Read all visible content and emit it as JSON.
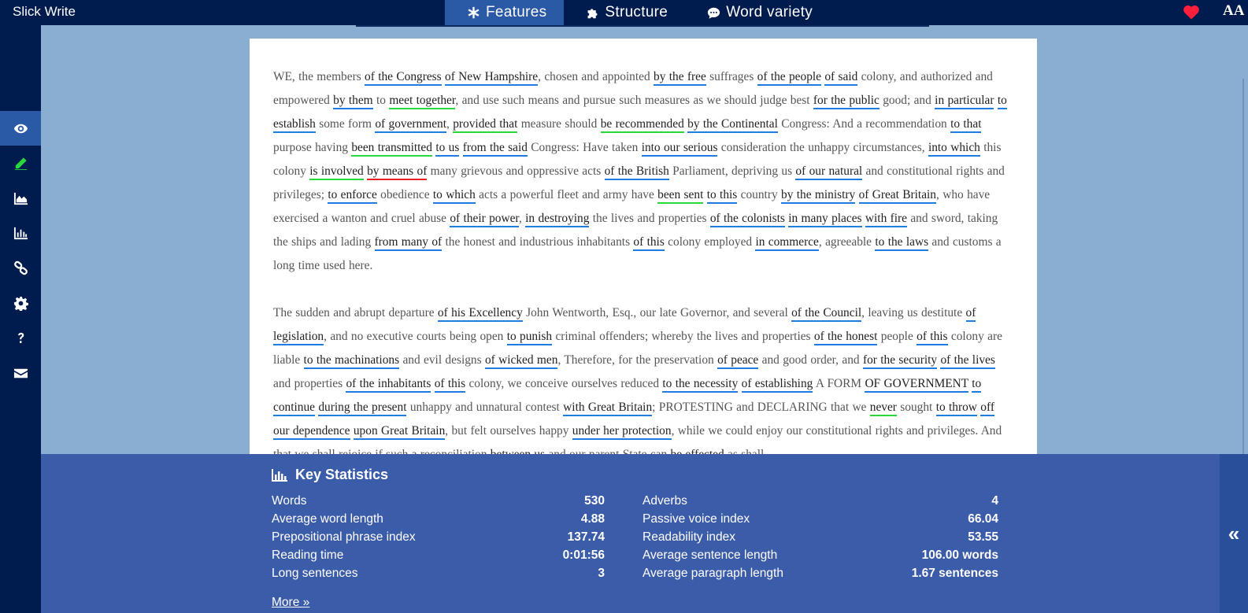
{
  "app": {
    "title": "Slick Write"
  },
  "tabs": [
    {
      "label": "Features",
      "icon": "asterisk-icon",
      "active": true
    },
    {
      "label": "Structure",
      "icon": "puzzle-icon",
      "active": false
    },
    {
      "label": "Word variety",
      "icon": "speech-bubble-icon",
      "active": false
    }
  ],
  "top_right": {
    "heart_icon": "heart-icon",
    "font_toggle": "AA"
  },
  "sidebar": [
    {
      "icon": "eye-icon",
      "active": true
    },
    {
      "icon": "pencil-icon",
      "active": false
    },
    {
      "icon": "area-chart-icon",
      "active": false
    },
    {
      "icon": "bar-chart-icon",
      "active": false
    },
    {
      "icon": "link-icon",
      "active": false
    },
    {
      "icon": "gear-icon",
      "active": false
    },
    {
      "icon": "question-icon",
      "active": false
    },
    {
      "icon": "envelope-icon",
      "active": false
    }
  ],
  "colors": {
    "prepositional": "#1e7de0",
    "passive": "#27d83a",
    "weak_word": "#e82020"
  },
  "document": {
    "paragraphs": [
      [
        [
          "t",
          "WE, the members "
        ],
        [
          "pp",
          "of the Congress"
        ],
        [
          "t",
          " "
        ],
        [
          "pp",
          "of New Hampshire"
        ],
        [
          "t",
          ", chosen and appointed "
        ],
        [
          "pp",
          "by the free"
        ],
        [
          "t",
          " suffrages "
        ],
        [
          "pp",
          "of the people"
        ],
        [
          "t",
          " "
        ],
        [
          "pp",
          "of said"
        ],
        [
          "t",
          " colony, and authorized and empowered "
        ],
        [
          "pp",
          "by them"
        ],
        [
          "t",
          " to "
        ],
        [
          "pv",
          "meet together"
        ],
        [
          "t",
          ", and use such means and pursue such measures as we should judge best "
        ],
        [
          "pp",
          "for the public"
        ],
        [
          "t",
          " good; and "
        ],
        [
          "pp",
          "in particular"
        ],
        [
          "t",
          " "
        ],
        [
          "pp",
          "to establish"
        ],
        [
          "t",
          " some form "
        ],
        [
          "pp",
          "of government"
        ],
        [
          "t",
          ", "
        ],
        [
          "pv",
          "provided that"
        ],
        [
          "t",
          " measure should "
        ],
        [
          "pv",
          "be recommended"
        ],
        [
          "t",
          " "
        ],
        [
          "pp",
          "by the Continental"
        ],
        [
          "t",
          " Congress: And a recommendation "
        ],
        [
          "pp",
          "to that"
        ],
        [
          "t",
          " purpose having "
        ],
        [
          "pv",
          "been transmitted"
        ],
        [
          "t",
          " "
        ],
        [
          "pp",
          "to us"
        ],
        [
          "t",
          " "
        ],
        [
          "pp",
          "from the said"
        ],
        [
          "t",
          " Congress: Have taken "
        ],
        [
          "pp",
          "into our serious"
        ],
        [
          "t",
          " consideration the unhappy circumstances, "
        ],
        [
          "pp",
          "into which"
        ],
        [
          "t",
          " this colony "
        ],
        [
          "pv",
          "is involved"
        ],
        [
          "t",
          " "
        ],
        [
          "wd",
          "by means of"
        ],
        [
          "t",
          " many grievous and oppressive acts "
        ],
        [
          "pp",
          "of the British"
        ],
        [
          "t",
          " Parliament, depriving us "
        ],
        [
          "pp",
          "of our natural"
        ],
        [
          "t",
          " and constitutional rights and privileges; "
        ],
        [
          "pp",
          "to enforce"
        ],
        [
          "t",
          " obedience "
        ],
        [
          "pp",
          "to which"
        ],
        [
          "t",
          " acts a powerful fleet and army have "
        ],
        [
          "pv",
          "been sent"
        ],
        [
          "t",
          " "
        ],
        [
          "pp",
          "to this"
        ],
        [
          "t",
          " country "
        ],
        [
          "pp",
          "by the ministry"
        ],
        [
          "t",
          " "
        ],
        [
          "pp",
          "of Great Britain"
        ],
        [
          "t",
          ", who have exercised a wanton and cruel abuse "
        ],
        [
          "pp",
          "of their power"
        ],
        [
          "t",
          ", "
        ],
        [
          "pp",
          "in destroying"
        ],
        [
          "t",
          " the lives and properties "
        ],
        [
          "pp",
          "of the colonists"
        ],
        [
          "t",
          " "
        ],
        [
          "pp",
          "in many places"
        ],
        [
          "t",
          " "
        ],
        [
          "pp",
          "with fire"
        ],
        [
          "t",
          " and sword, taking the ships and lading "
        ],
        [
          "pp",
          "from many of"
        ],
        [
          "t",
          " the honest and industrious inhabitants "
        ],
        [
          "pp",
          "of this"
        ],
        [
          "t",
          " colony employed "
        ],
        [
          "pp",
          "in commerce"
        ],
        [
          "t",
          ", agreeable "
        ],
        [
          "pp",
          "to the laws"
        ],
        [
          "t",
          " and customs a long time used here."
        ]
      ],
      [
        [
          "t",
          "The sudden and abrupt departure "
        ],
        [
          "pp",
          "of his Excellency"
        ],
        [
          "t",
          " John Wentworth, Esq., our late Governor, and several "
        ],
        [
          "pp",
          "of the Council"
        ],
        [
          "t",
          ", leaving us destitute "
        ],
        [
          "pp",
          "of legislation"
        ],
        [
          "t",
          ", and no executive courts being open "
        ],
        [
          "pp",
          "to punish"
        ],
        [
          "t",
          " criminal offenders; whereby the lives and properties "
        ],
        [
          "pp",
          "of the honest"
        ],
        [
          "t",
          " people "
        ],
        [
          "pp",
          "of this"
        ],
        [
          "t",
          " colony are liable "
        ],
        [
          "pp",
          "to the machinations"
        ],
        [
          "t",
          " and evil designs "
        ],
        [
          "pp",
          "of wicked men"
        ],
        [
          "t",
          ", Therefore, for the preservation "
        ],
        [
          "pp",
          "of peace"
        ],
        [
          "t",
          " and good order, and "
        ],
        [
          "pp",
          "for the security"
        ],
        [
          "t",
          " "
        ],
        [
          "pp",
          "of the lives"
        ],
        [
          "t",
          " and properties "
        ],
        [
          "pp",
          "of the inhabitants"
        ],
        [
          "t",
          " "
        ],
        [
          "pp",
          "of this"
        ],
        [
          "t",
          " colony, we conceive ourselves reduced "
        ],
        [
          "pp",
          "to the necessity"
        ],
        [
          "t",
          " "
        ],
        [
          "pp",
          "of establishing"
        ],
        [
          "t",
          " A FORM "
        ],
        [
          "pp",
          "OF GOVERNMENT"
        ],
        [
          "t",
          " "
        ],
        [
          "pp",
          "to continue"
        ],
        [
          "t",
          " "
        ],
        [
          "pp",
          "during the present"
        ],
        [
          "t",
          " unhappy and unnatural contest "
        ],
        [
          "pp",
          "with Great Britain"
        ],
        [
          "t",
          "; PROTESTING and DECLARING that we "
        ],
        [
          "pv",
          "never"
        ],
        [
          "t",
          " sought "
        ],
        [
          "pp",
          "to throw"
        ],
        [
          "t",
          " "
        ],
        [
          "pp",
          "off our dependence"
        ],
        [
          "t",
          " "
        ],
        [
          "pp",
          "upon Great Britain"
        ],
        [
          "t",
          ", but felt ourselves happy "
        ],
        [
          "pp",
          "under her protection"
        ],
        [
          "t",
          ", while we could enjoy our constitutional rights and privileges. And that we shall rejoice if such a reconciliation "
        ],
        [
          "pp",
          "between us"
        ],
        [
          "t",
          " and our parent State can "
        ],
        [
          "pv",
          "be effected"
        ],
        [
          "t",
          " as shall"
        ]
      ]
    ]
  },
  "stats": {
    "title": "Key Statistics",
    "left": [
      {
        "label": "Words",
        "value": "530"
      },
      {
        "label": "Average word length",
        "value": "4.88"
      },
      {
        "label": "Prepositional phrase index",
        "value": "137.74"
      },
      {
        "label": "Reading time",
        "value": "0:01:56"
      },
      {
        "label": "Long sentences",
        "value": "3"
      }
    ],
    "right": [
      {
        "label": "Adverbs",
        "value": "4"
      },
      {
        "label": "Passive voice index",
        "value": "66.04"
      },
      {
        "label": "Readability index",
        "value": "53.55"
      },
      {
        "label": "Average sentence length",
        "value": "106.00 words"
      },
      {
        "label": "Average paragraph length",
        "value": "1.67 sentences"
      }
    ],
    "more_label": "More »",
    "collapse_label": "«"
  }
}
